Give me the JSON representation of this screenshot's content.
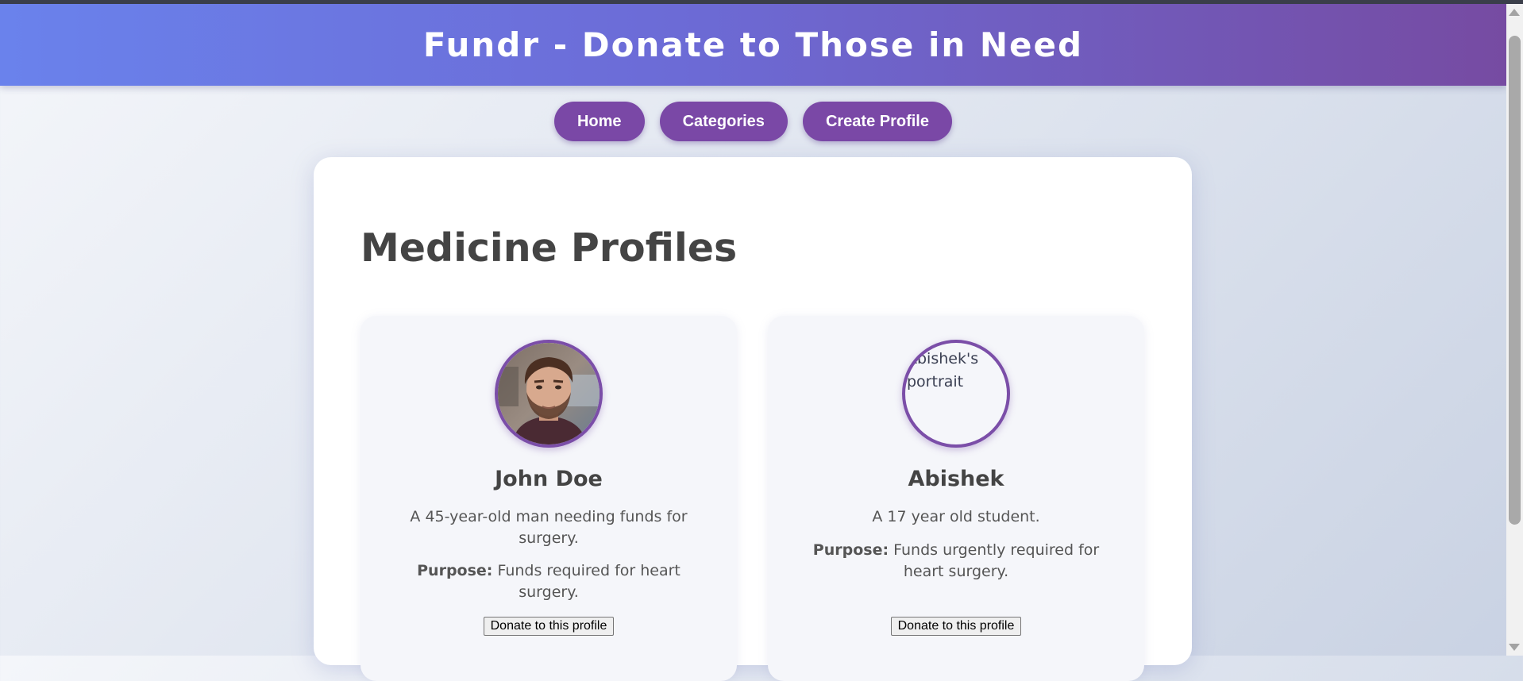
{
  "header": {
    "title": "Fundr - Donate to Those in Need"
  },
  "nav": {
    "items": [
      {
        "label": "Home"
      },
      {
        "label": "Categories"
      },
      {
        "label": "Create Profile"
      }
    ]
  },
  "main": {
    "heading": "Medicine Profiles",
    "profiles": [
      {
        "name": "John Doe",
        "avatar": "portrait-photo",
        "description": "A 45-year-old man needing funds for surgery.",
        "purpose_label": "Purpose:",
        "purpose": "Funds required for heart surgery.",
        "donate_label": "Donate to this profile"
      },
      {
        "name": "Abishek",
        "avatar_alt": "Abishek's portrait",
        "description": "A 17 year old student.",
        "purpose_label": "Purpose:",
        "purpose": "Funds urgently required for heart surgery.",
        "donate_label": "Donate to this profile"
      }
    ]
  },
  "colors": {
    "header_start": "#6a82ec",
    "header_end": "#764ba2",
    "accent": "#7a48a6"
  }
}
